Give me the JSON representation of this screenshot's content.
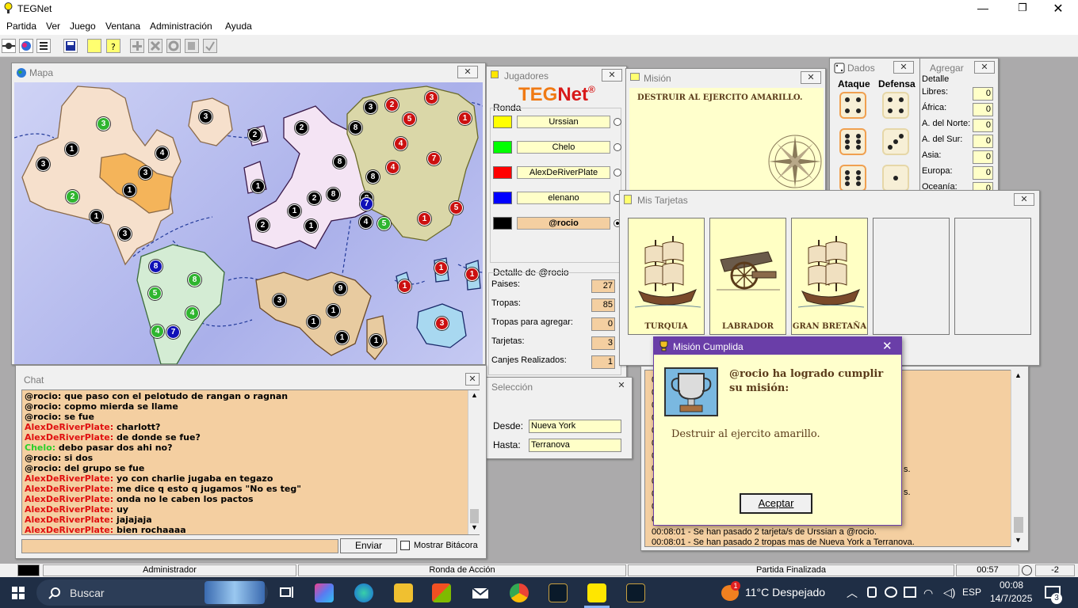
{
  "app": {
    "title": "TEGNet"
  },
  "menu": [
    "Partida",
    "Ver",
    "Juego",
    "Ventana",
    "Administración",
    "Ayuda"
  ],
  "map": {
    "title": "Mapa",
    "armies": [
      {
        "n": "3",
        "c": "g"
      },
      {
        "n": "1",
        "c": "k"
      },
      {
        "n": "3",
        "c": "k"
      },
      {
        "n": "4",
        "c": "k"
      },
      {
        "n": "3",
        "c": "k"
      },
      {
        "n": "1",
        "c": "k"
      },
      {
        "n": "2",
        "c": "g"
      },
      {
        "n": "1",
        "c": "k"
      },
      {
        "n": "3",
        "c": "k"
      },
      {
        "n": "3",
        "c": "k"
      },
      {
        "n": "2",
        "c": "k"
      },
      {
        "n": "1",
        "c": "k"
      },
      {
        "n": "2",
        "c": "k"
      },
      {
        "n": "8",
        "c": "k"
      },
      {
        "n": "2",
        "c": "k"
      },
      {
        "n": "8",
        "c": "k"
      },
      {
        "n": "1",
        "c": "k"
      },
      {
        "n": "1",
        "c": "k"
      },
      {
        "n": "2",
        "c": "k"
      },
      {
        "n": "3",
        "c": "k"
      },
      {
        "n": "2",
        "c": "r"
      },
      {
        "n": "3",
        "c": "r"
      },
      {
        "n": "1",
        "c": "r"
      },
      {
        "n": "8",
        "c": "k"
      },
      {
        "n": "5",
        "c": "r"
      },
      {
        "n": "4",
        "c": "r"
      },
      {
        "n": "8",
        "c": "k"
      },
      {
        "n": "4",
        "c": "r"
      },
      {
        "n": "7",
        "c": "r"
      },
      {
        "n": "8",
        "c": "k"
      },
      {
        "n": "7",
        "c": "b"
      },
      {
        "n": "4",
        "c": "k"
      },
      {
        "n": "5",
        "c": "g"
      },
      {
        "n": "1",
        "c": "r"
      },
      {
        "n": "5",
        "c": "r"
      },
      {
        "n": "1",
        "c": "r"
      },
      {
        "n": "1",
        "c": "r"
      },
      {
        "n": "1",
        "c": "r"
      },
      {
        "n": "3",
        "c": "r"
      },
      {
        "n": "8",
        "c": "b"
      },
      {
        "n": "8",
        "c": "g"
      },
      {
        "n": "5",
        "c": "g"
      },
      {
        "n": "4",
        "c": "g"
      },
      {
        "n": "4",
        "c": "g"
      },
      {
        "n": "7",
        "c": "b"
      },
      {
        "n": "9",
        "c": "k"
      },
      {
        "n": "3",
        "c": "k"
      },
      {
        "n": "1",
        "c": "k"
      },
      {
        "n": "1",
        "c": "k"
      },
      {
        "n": "1",
        "c": "k"
      },
      {
        "n": "1",
        "c": "k"
      }
    ]
  },
  "chat": {
    "title": "Chat",
    "lines": [
      {
        "u": "@rocio:",
        "c": "uk",
        "m": "que paso con el pelotudo de rangan o ragnan"
      },
      {
        "u": "@rocio:",
        "c": "uk",
        "m": "copmo mierda se llame"
      },
      {
        "u": "@rocio:",
        "c": "uk",
        "m": "se fue"
      },
      {
        "u": "AlexDeRiverPlate:",
        "c": "ur",
        "m": "charlott?"
      },
      {
        "u": "AlexDeRiverPlate:",
        "c": "ur",
        "m": "de donde se fue?"
      },
      {
        "u": "Chelo:",
        "c": "ug",
        "m": "debo pasar dos ahi no?"
      },
      {
        "u": "@rocio:",
        "c": "uk",
        "m": "si dos"
      },
      {
        "u": "@rocio:",
        "c": "uk",
        "m": "del grupo se fue"
      },
      {
        "u": "AlexDeRiverPlate:",
        "c": "ur",
        "m": "yo con charlie jugaba en tegazo"
      },
      {
        "u": "AlexDeRiverPlate:",
        "c": "ur",
        "m": "me dice q esto q jugamos \"No es teg\""
      },
      {
        "u": "AlexDeRiverPlate:",
        "c": "ur",
        "m": "onda no le caben los pactos"
      },
      {
        "u": "AlexDeRiverPlate:",
        "c": "ur",
        "m": "uy"
      },
      {
        "u": "AlexDeRiverPlate:",
        "c": "ur",
        "m": "jajajaja"
      },
      {
        "u": "AlexDeRiverPlate:",
        "c": "ur",
        "m": "bien rochaaaa"
      }
    ],
    "send_label": "Enviar",
    "log_label": "Mostrar Bitácora"
  },
  "players": {
    "title": "Jugadores",
    "logo_teg": "TEG",
    "logo_net": "Net",
    "logo_reg": "®",
    "group": "Ronda",
    "list": [
      {
        "name": "Urssian",
        "color": "#ffff00"
      },
      {
        "name": "Chelo",
        "color": "#00ff00"
      },
      {
        "name": "AlexDeRiverPlate",
        "color": "#ff0000"
      },
      {
        "name": "elenano",
        "color": "#0000ff"
      },
      {
        "name": "@rocio",
        "color": "#000000"
      }
    ],
    "detail_title": "Detalle de @rocio",
    "detail": [
      {
        "label": "Paises:",
        "value": "27"
      },
      {
        "label": "Tropas:",
        "value": "85"
      },
      {
        "label": "Tropas para agregar:",
        "value": "0"
      },
      {
        "label": "Tarjetas:",
        "value": "3"
      },
      {
        "label": "Canjes Realizados:",
        "value": "1"
      }
    ]
  },
  "seleccion": {
    "title": "Selección",
    "desde_label": "Desde:",
    "desde": "Nueva York",
    "hasta_label": "Hasta:",
    "hasta": "Terranova"
  },
  "mision": {
    "title": "Misión",
    "text": "DESTRUIR AL EJERCITO AMARILLO."
  },
  "dados": {
    "title": "Dados",
    "ataque": "Ataque",
    "defensa": "Defensa",
    "attack": [
      4,
      6,
      6
    ],
    "defense": [
      4,
      3,
      1
    ]
  },
  "agregar": {
    "title": "Agregar",
    "group": "Detalle",
    "rows": [
      {
        "label": "Libres:",
        "value": "0"
      },
      {
        "label": "África:",
        "value": "0"
      },
      {
        "label": "A. del Norte:",
        "value": "0"
      },
      {
        "label": "A. del Sur:",
        "value": "0"
      },
      {
        "label": "Asia:",
        "value": "0"
      },
      {
        "label": "Europa:",
        "value": "0"
      },
      {
        "label": "Oceanía:",
        "value": "0"
      }
    ]
  },
  "tarjetas": {
    "title": "Mis Tarjetas",
    "cards": [
      {
        "name": "TURQUIA",
        "art": "ship"
      },
      {
        "name": "LABRADOR",
        "art": "cannon"
      },
      {
        "name": "GRAN BRETAÑA",
        "art": "ship"
      }
    ]
  },
  "log": {
    "lines": [
      "s.",
      "s.",
      "00:08:01 - Se han pasado 2 tarjeta/s de Urssian a @rocio.",
      "00:08:01 - Se han pasado 2 tropas mas de Nueva York a Terranova."
    ]
  },
  "dialog": {
    "title": "Misión Cumplida",
    "heading": "@rocio ha logrado cumplir su misión:",
    "text": "Destruir al ejercito amarillo.",
    "ok": "Aceptar"
  },
  "status": {
    "role": "Administrador",
    "round": "Ronda de Acción",
    "state": "Partida Finalizada",
    "time": "00:57",
    "num": "-2"
  },
  "taskbar": {
    "search": "Buscar",
    "weather": "11°C  Despejado",
    "weather_badge": "1",
    "lang": "ESP",
    "clock": "00:08",
    "date": "14/7/2025",
    "notif": "3"
  }
}
